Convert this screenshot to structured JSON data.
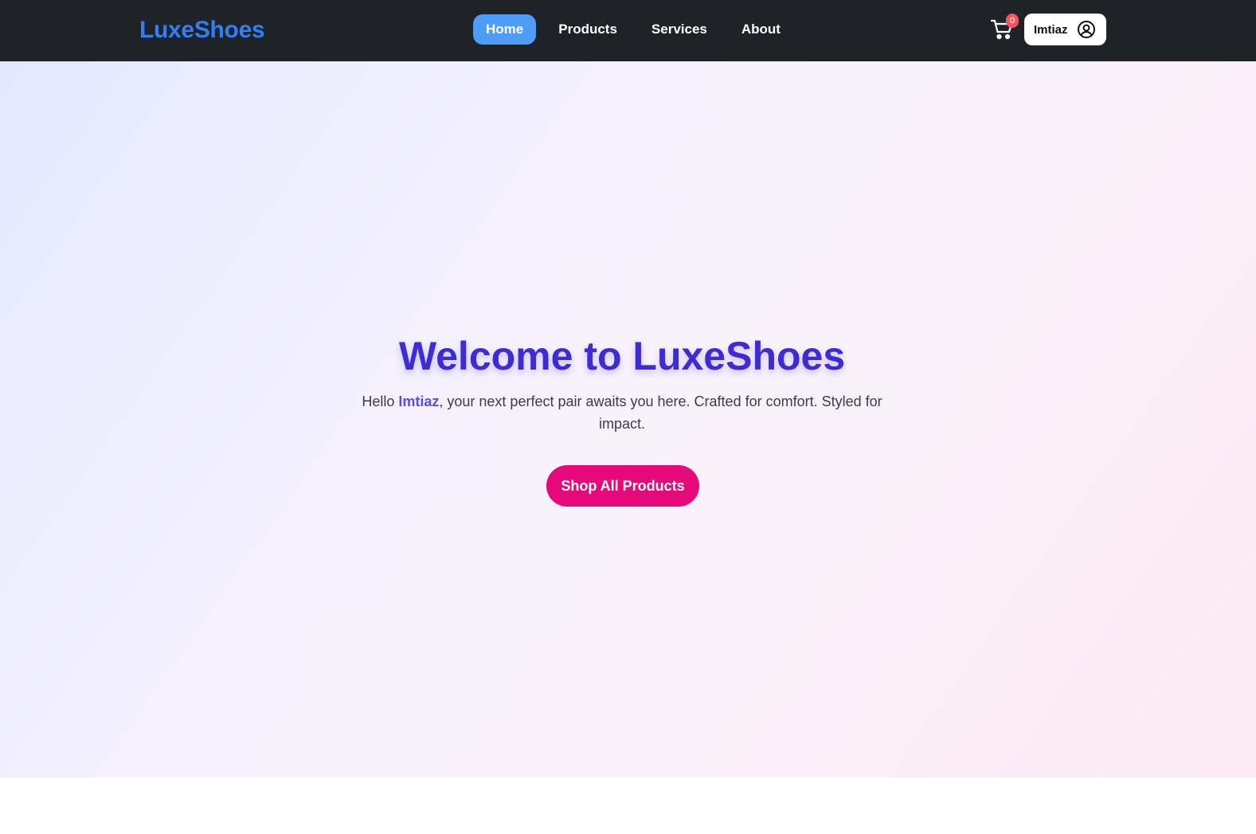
{
  "header": {
    "brand": "LuxeShoes",
    "nav": [
      {
        "label": "Home",
        "active": true
      },
      {
        "label": "Products",
        "active": false
      },
      {
        "label": "Services",
        "active": false
      },
      {
        "label": "About",
        "active": false
      }
    ],
    "cart_count": "0",
    "cart_icon": "shopping-cart-icon",
    "user": {
      "name": "Imtiaz",
      "icon": "user-circle-icon"
    }
  },
  "hero": {
    "title": "Welcome to LuxeShoes",
    "greeting_prefix": "Hello ",
    "user_name": "Imtiaz",
    "greeting_suffix": ", your next perfect pair awaits you here. Crafted for comfort. Styled for impact.",
    "cta_label": "Shop All Products"
  },
  "colors": {
    "navbar": "#1f2228",
    "brand": "#2f80f6",
    "active_nav": "#4f9cf7",
    "title": "#3d2bd4",
    "cta": "#e5097a",
    "badge": "#f0565e"
  }
}
